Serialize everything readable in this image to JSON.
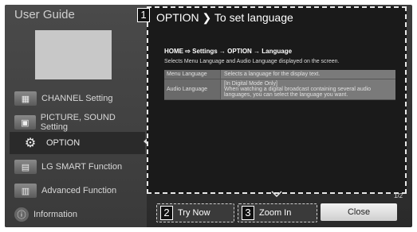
{
  "sidebar": {
    "title": "User Guide",
    "items": [
      {
        "label": "CHANNEL Setting",
        "icon": "channel-icon"
      },
      {
        "label": "PICTURE, SOUND Setting",
        "icon": "picture-sound-icon"
      },
      {
        "label": "OPTION",
        "icon": "gear-icon",
        "selected": true
      },
      {
        "label": "LG SMART Function",
        "icon": "smart-icon"
      },
      {
        "label": "Advanced Function",
        "icon": "advanced-icon"
      },
      {
        "label": "Information",
        "icon": "info-icon"
      }
    ]
  },
  "panel": {
    "badge": "1",
    "title": "OPTION ❯ To set language",
    "breadcrumb": "HOME ⇨ Settings → OPTION → Language",
    "description": "Selects Menu Language and Audio Language displayed on the screen.",
    "table": [
      {
        "key": "Menu Language",
        "value": "Selects a language for the display text."
      },
      {
        "key": "Audio Language",
        "value": "[In Digital Mode Only]\nWhen watching a digital broadcast containing several audio languages, you can select the language you want."
      }
    ],
    "pager": "1/2"
  },
  "buttons": {
    "try_now": {
      "badge": "2",
      "label": "Try Now"
    },
    "zoom_in": {
      "badge": "3",
      "label": "Zoom In"
    },
    "close": {
      "label": "Close"
    }
  },
  "colors": {
    "panel_bg": "#1a1a1a",
    "sidebar_bg": "#444444",
    "accent": "#ffffff"
  }
}
